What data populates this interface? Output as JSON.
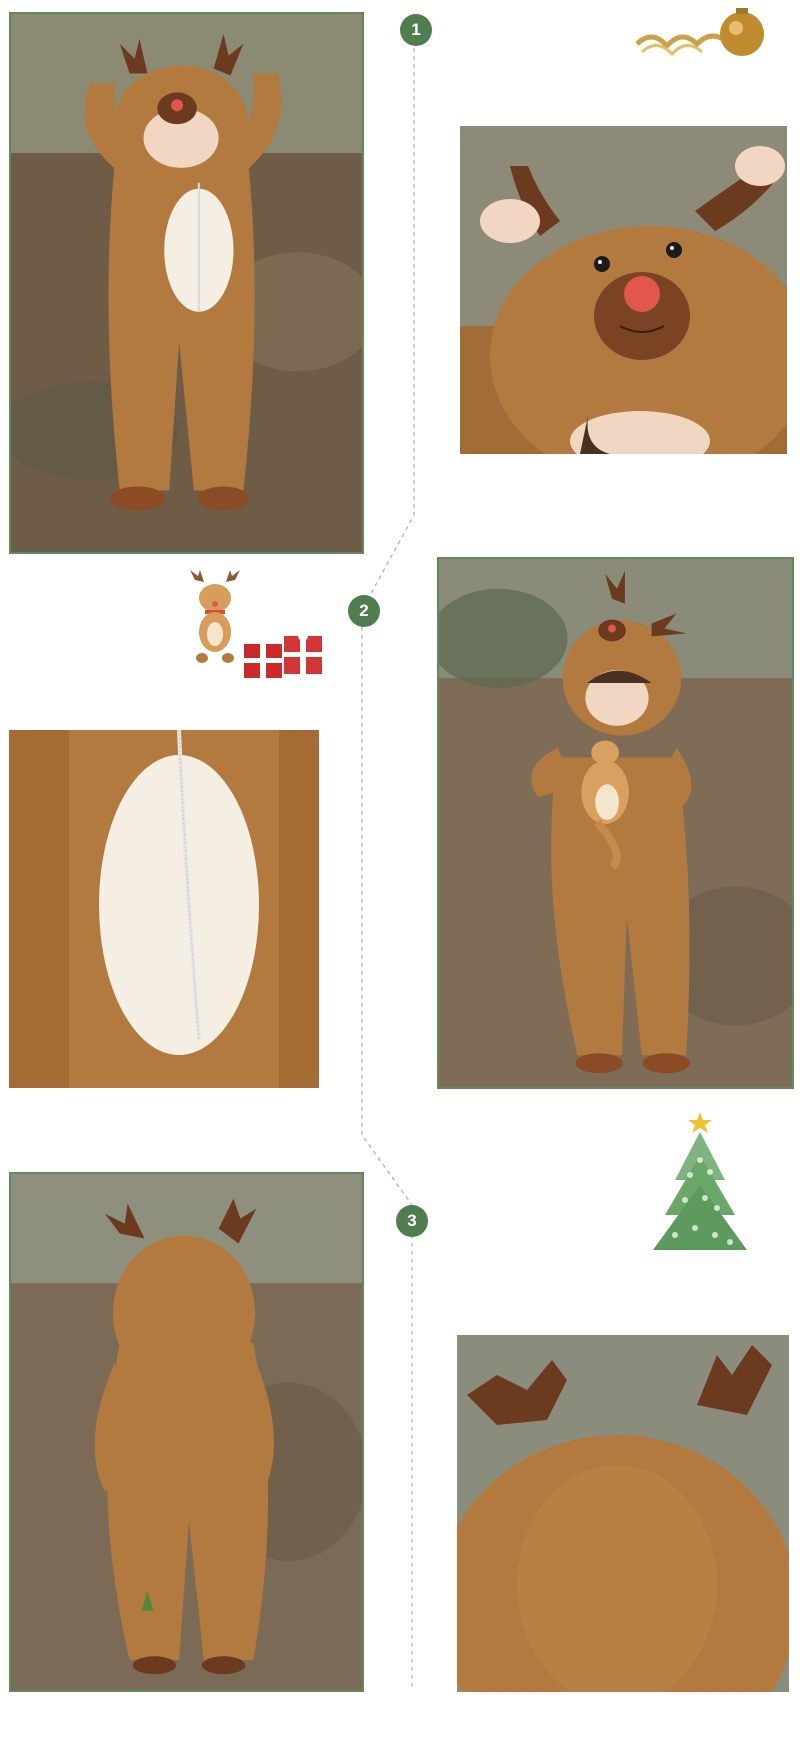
{
  "steps": [
    "1",
    "2",
    "3"
  ],
  "captions": {
    "detail_face": [
      "",
      "",
      ""
    ],
    "detail_belly": [
      "",
      "",
      ""
    ]
  },
  "colors": {
    "frame_green": "#5f8a5c",
    "badge_green": "#4f7d4f",
    "fleece_brown": "#b27a3e",
    "antler_brown": "#6b3a1f",
    "belly_cream": "#f4efe2",
    "nose_red": "#e2574c"
  },
  "icons": [
    "gold-ornament-icon",
    "reindeer-plush-icon",
    "gift-boxes-icon",
    "christmas-tree-icon"
  ]
}
